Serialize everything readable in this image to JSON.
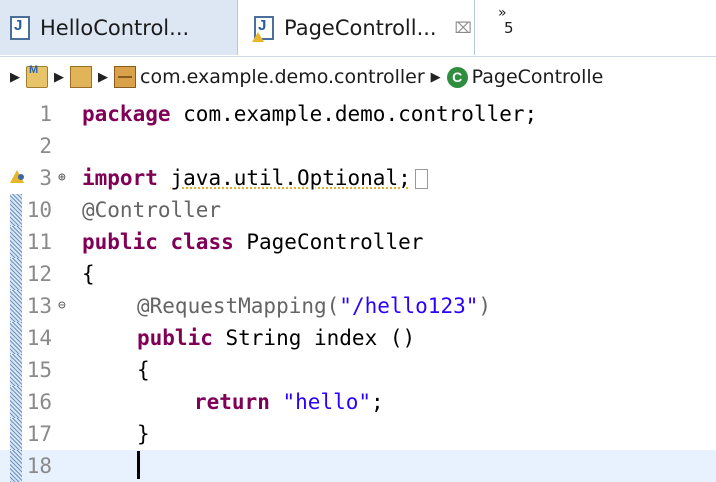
{
  "tabs": [
    {
      "label": "HelloControl...",
      "active": false
    },
    {
      "label": "PageControll...",
      "active": true,
      "close_glyph": "⌧"
    }
  ],
  "tab_overflow": {
    "chevron": "»",
    "count": "5"
  },
  "breadcrumb": {
    "separator": "▶",
    "package": "com.example.demo.controller",
    "class": "PageControlle"
  },
  "editor": {
    "lines": [
      {
        "number": "1",
        "text": "package com.example.demo.controller;"
      },
      {
        "number": "2",
        "text": ""
      },
      {
        "number": "3",
        "text": "import java.util.Optional;",
        "fold": "⊕",
        "warning": true
      },
      {
        "number": "10",
        "text": "@Controller"
      },
      {
        "number": "11",
        "text": "public class PageController"
      },
      {
        "number": "12",
        "text": "{"
      },
      {
        "number": "13",
        "text": "@RequestMapping(\"/hello123\")",
        "fold": "⊖"
      },
      {
        "number": "14",
        "text": "public String index ()"
      },
      {
        "number": "15",
        "text": "{"
      },
      {
        "number": "16",
        "text": "return \"hello\";"
      },
      {
        "number": "17",
        "text": "}"
      },
      {
        "number": "18",
        "text": ""
      }
    ],
    "tokens": {
      "package_kw": "package",
      "package_name": " com.example.demo.controller;",
      "import_kw": "import",
      "import_name": "java.util.Optional;",
      "annotation_controller": "@Controller",
      "public_kw": "public",
      "class_kw": "class",
      "class_name": " PageController",
      "open_brace": "{",
      "close_brace": "}",
      "annotation_mapping": "@RequestMapping(",
      "mapping_value": "\"/hello123\"",
      "mapping_close": ")",
      "string_type": " String index ()",
      "return_kw": "return",
      "return_value": "\"hello\"",
      "semicolon": ";"
    }
  },
  "colors": {
    "keyword": "#7f0055",
    "string": "#2a00ff",
    "annotation": "#646464",
    "current_line": "#e8f2fe"
  }
}
